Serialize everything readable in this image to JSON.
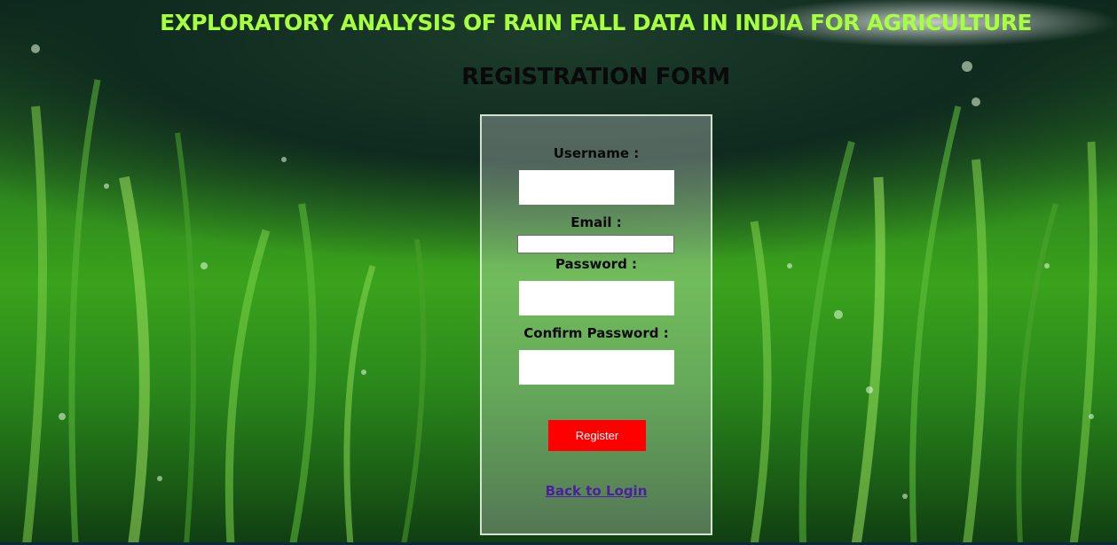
{
  "header": {
    "title": "EXPLORATORY ANALYSIS OF RAIN FALL DATA IN INDIA FOR AGRICULTURE"
  },
  "form": {
    "title": "REGISTRATION FORM",
    "username_label": "Username :",
    "username_value": "",
    "email_label": "Email :",
    "email_value": "",
    "password_label": "Password :",
    "password_value": "",
    "confirm_password_label": "Confirm Password :",
    "confirm_password_value": "",
    "register_label": "Register",
    "back_link_label": "Back to Login"
  },
  "colors": {
    "title": "#a6ff3f",
    "register_button": "#ff0000",
    "link": "#4b1fa0"
  }
}
